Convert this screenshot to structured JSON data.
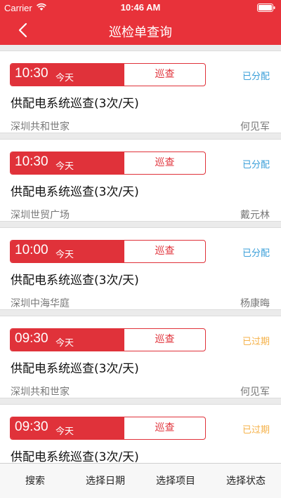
{
  "status_bar": {
    "carrier": "Carrier",
    "time": "10:46 AM"
  },
  "header": {
    "title": "巡检单查询"
  },
  "cards": [
    {
      "time": "10:30",
      "day": "今天",
      "type": "巡查",
      "status": "已分配",
      "status_kind": "assigned",
      "title": "供配电系统巡查(3次/天)",
      "location": "深圳共和世家",
      "person": "何见军"
    },
    {
      "time": "10:30",
      "day": "今天",
      "type": "巡查",
      "status": "已分配",
      "status_kind": "assigned",
      "title": "供配电系统巡查(3次/天)",
      "location": "深圳世贸广场",
      "person": "戴元林"
    },
    {
      "time": "10:00",
      "day": "今天",
      "type": "巡查",
      "status": "已分配",
      "status_kind": "assigned",
      "title": "供配电系统巡查(3次/天)",
      "location": "深圳中海华庭",
      "person": "杨康晦"
    },
    {
      "time": "09:30",
      "day": "今天",
      "type": "巡查",
      "status": "已过期",
      "status_kind": "expired",
      "title": "供配电系统巡查(3次/天)",
      "location": "深圳共和世家",
      "person": "何见军"
    },
    {
      "time": "09:30",
      "day": "今天",
      "type": "巡查",
      "status": "已过期",
      "status_kind": "expired",
      "title": "供配电系统巡查(3次/天)",
      "location": "",
      "person": ""
    }
  ],
  "tabs": [
    "搜索",
    "选择日期",
    "选择项目",
    "选择状态"
  ],
  "colors": {
    "brand": "#e8323a",
    "assigned": "#3a9fd9",
    "expired": "#f5b24a"
  }
}
